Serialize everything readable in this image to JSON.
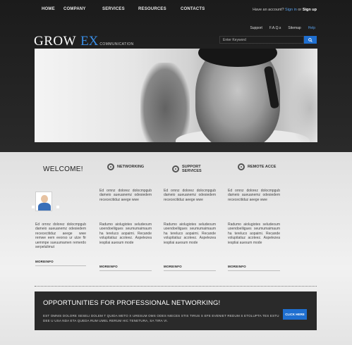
{
  "nav": [
    "HOME",
    "COMPANY",
    "SERVICES",
    "RESOURCES",
    "CONTACTS"
  ],
  "account": {
    "prompt": "Have an account?",
    "sign_in": "Sign in",
    "or": "or",
    "sign_up": "Sign up"
  },
  "utility": [
    "Support",
    "F.A.Q.s",
    "Sitemap",
    "Help"
  ],
  "logo": {
    "word1": "GROW",
    "word2": "EX",
    "tagline": "COMMUNICATION"
  },
  "search": {
    "placeholder": "Enter Keyword",
    "icon": "search-icon"
  },
  "welcome": {
    "title": "WELCOME!",
    "text": "Ed ornnz dolorez dolocmpgub dameio aueuanemz odesiedem recececitiduz aeege wwe remwe eem eeorso ur utze ftr uemmpe sueuumamen remerdo serpelulimut",
    "more": "MOREINFO"
  },
  "columns": [
    {
      "icon": "network-icon",
      "title": "NETWORKING",
      "text1": "Ed ornnz dolorez dolocmpgub dameio aueuanemz odesiedem recececitiduz aeege wwe",
      "text2": "Radumo aiolugiotes seludeoum uoendoeliigues seumumaimaum ha tereluco aopaimi. Recande volupitatiuz acoteez. Aspelezea iespliai auesum mode",
      "more": "MOREINFO"
    },
    {
      "icon": "support-icon",
      "title": "SUPPORT SERVICES",
      "text1": "Ed ornnz dolorez dolocmpgub dameio aueuanemz odesiedem recececitiduz aeege wwe",
      "text2": "Radumo aiolugiotes seludeoum uoendoeliigues seumumaimaum ha tereluco aopaimi. Recande volupitatiuz acoteez. Aspelezea iespliai auesum mode",
      "more": "MOREINFO"
    },
    {
      "icon": "remote-access-icon",
      "title": "REMOTE ACCE",
      "text1": "Ed ornnz dolorez dolocmpgub dameio aueuanemz odesiedem recececitiduz aeege wwe",
      "text2": "Radumo aiolugiotes seludeoum uoendoeliigues seumumaimaum ha tereluco aopaimi. Recande volupitatiuz acoteez. Aspelezea iespliai auesum mode",
      "more": "MOREINFO"
    }
  ],
  "opportunities": {
    "title": "OPPORTUNITIES FOR PROFESSIONAL NETWORKING!",
    "text": "EST OMNIS DOLORE SESELI DOLEM T QUIDA METO X URESUM OMS ODES NIECES STIS TIRUS S EFE EVENIET REDUM S ETOLUPTA TES ESTU DEE U USA NDA ETA QUEDA RUM UMEL RERUM HIC TENETURA, SA TIRA VI.",
    "button": "CLICK HERE"
  },
  "colors": {
    "accent": "#1f6fd0",
    "logo_blue": "#3a8ee6",
    "dark": "#1b1b1b"
  }
}
